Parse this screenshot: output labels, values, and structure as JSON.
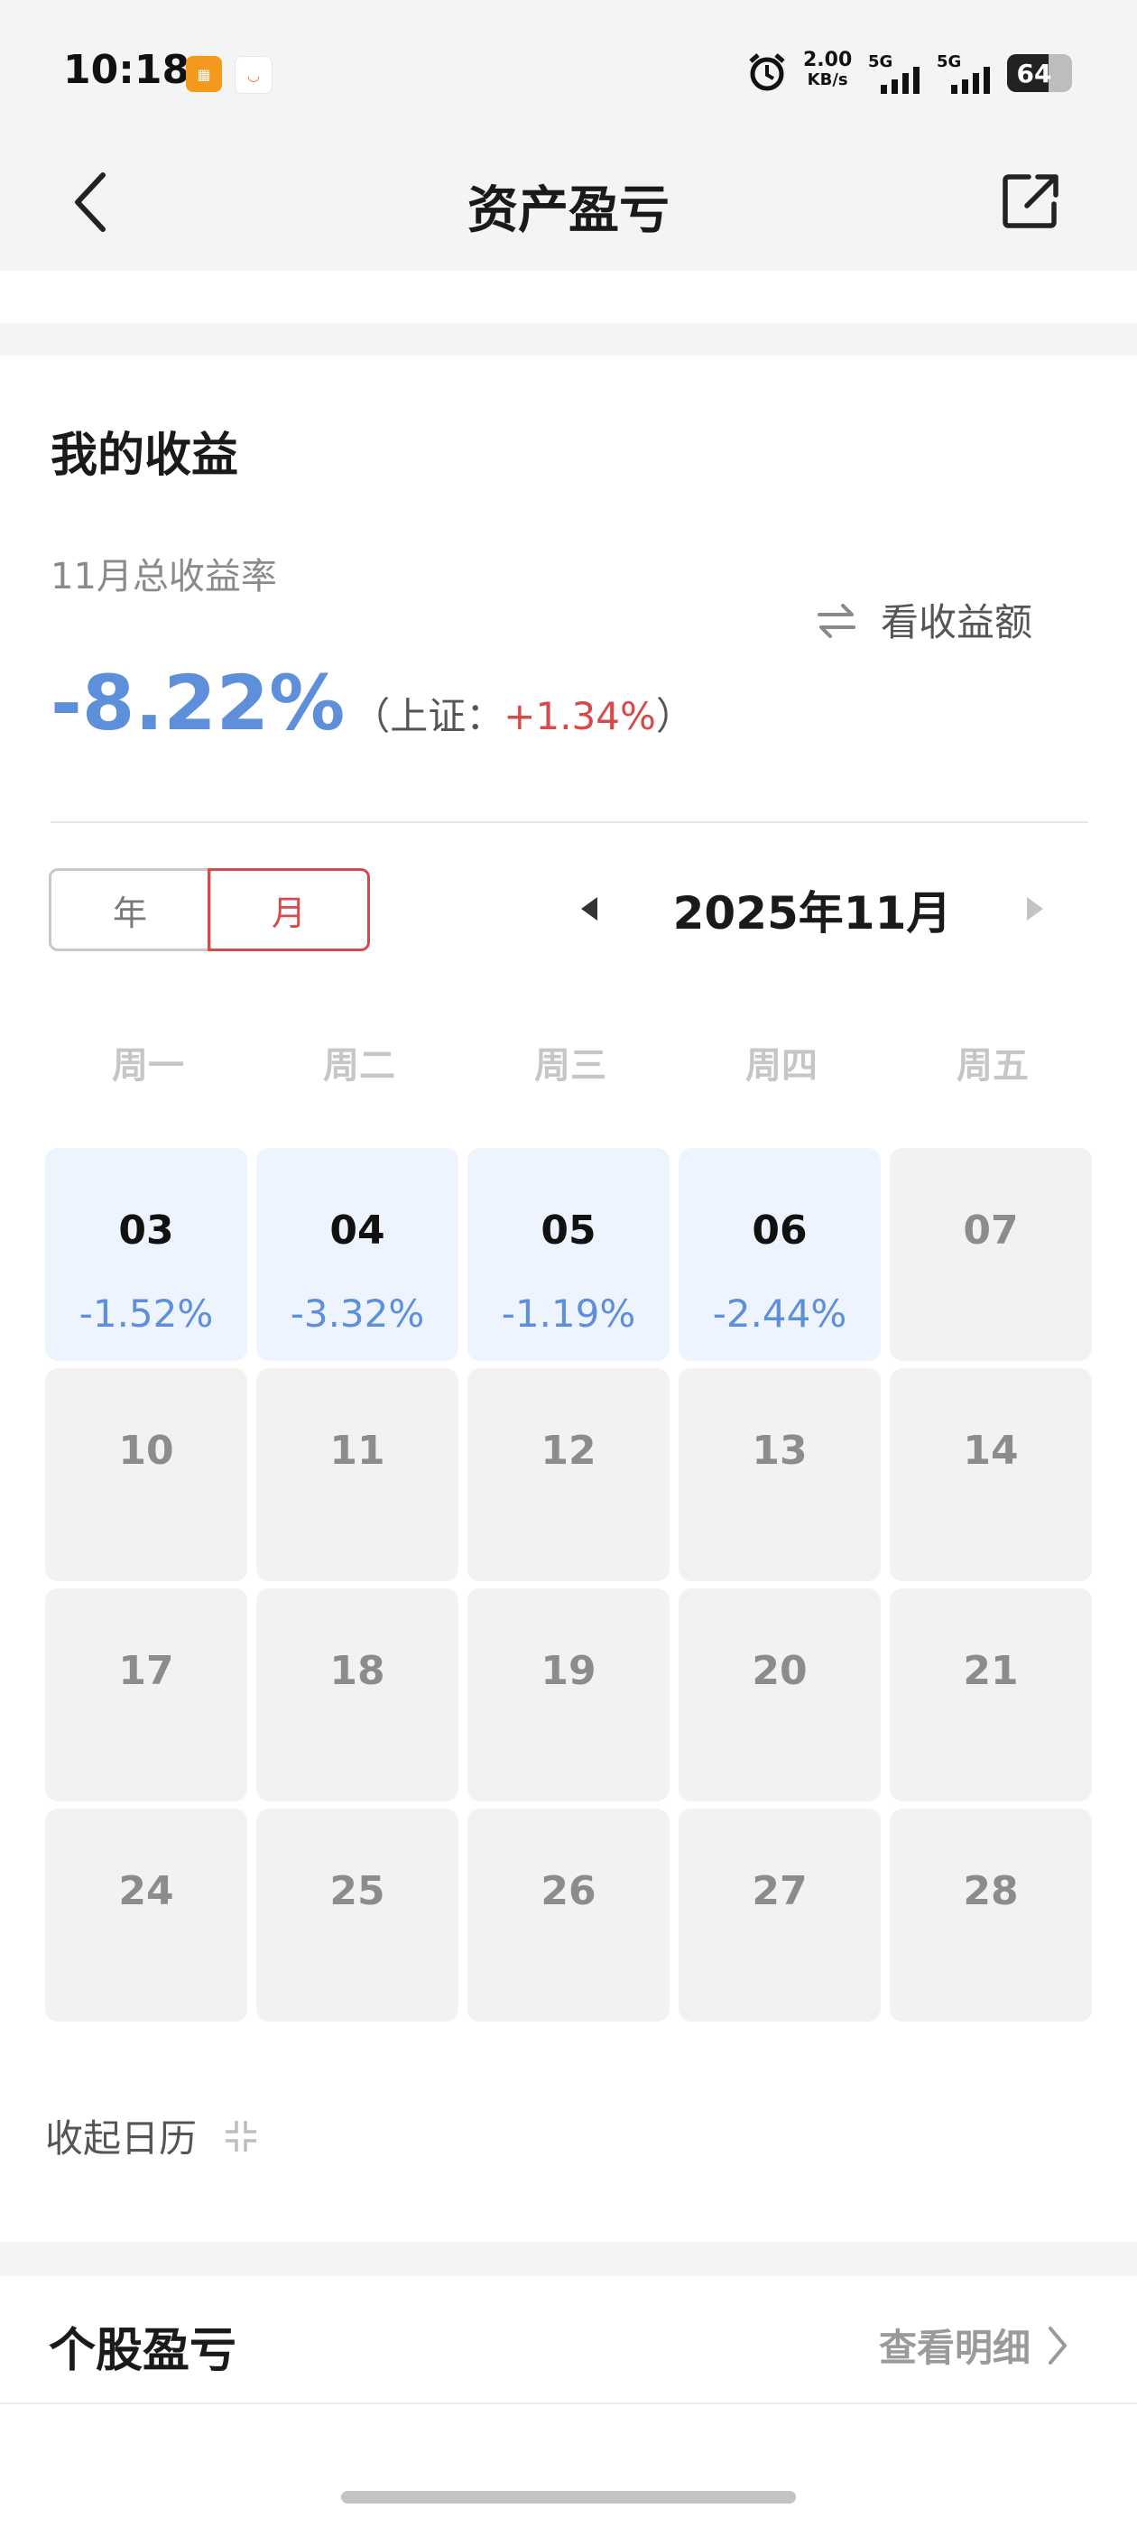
{
  "status_bar": {
    "time": "10:18",
    "app_icons": [
      "app-orange",
      "didi"
    ],
    "net_speed_value": "2.00",
    "net_speed_unit": "KB/s",
    "signal_1": "5G",
    "signal_2": "5G",
    "battery": "64"
  },
  "header": {
    "title": "资产盈亏",
    "back_icon": "chevron-left-icon",
    "share_icon": "share-external-icon"
  },
  "earnings": {
    "section_title": "我的收益",
    "period_label": "11月总收益率",
    "toggle_label": "看收益额",
    "rate": "-8.22%",
    "index_open": "（上证：",
    "index_value": "+1.34%",
    "index_close": "）",
    "colors": {
      "loss": "#5e8fda",
      "gain": "#d84a4a"
    }
  },
  "calendar": {
    "tab_year": "年",
    "tab_month": "月",
    "selected_tab": "月",
    "month_label": "2025年11月",
    "weekdays": [
      "周一",
      "周二",
      "周三",
      "周四",
      "周五"
    ],
    "rows": [
      [
        {
          "day": "03",
          "pct": "-1.52%"
        },
        {
          "day": "04",
          "pct": "-3.32%"
        },
        {
          "day": "05",
          "pct": "-1.19%"
        },
        {
          "day": "06",
          "pct": "-2.44%"
        },
        {
          "day": "07",
          "pct": ""
        }
      ],
      [
        {
          "day": "10",
          "pct": ""
        },
        {
          "day": "11",
          "pct": ""
        },
        {
          "day": "12",
          "pct": ""
        },
        {
          "day": "13",
          "pct": ""
        },
        {
          "day": "14",
          "pct": ""
        }
      ],
      [
        {
          "day": "17",
          "pct": ""
        },
        {
          "day": "18",
          "pct": ""
        },
        {
          "day": "19",
          "pct": ""
        },
        {
          "day": "20",
          "pct": ""
        },
        {
          "day": "21",
          "pct": ""
        }
      ],
      [
        {
          "day": "24",
          "pct": ""
        },
        {
          "day": "25",
          "pct": ""
        },
        {
          "day": "26",
          "pct": ""
        },
        {
          "day": "27",
          "pct": ""
        },
        {
          "day": "28",
          "pct": ""
        }
      ]
    ],
    "collapse_label": "收起日历"
  },
  "stocks": {
    "section_title": "个股盈亏",
    "detail_link": "查看明细"
  }
}
